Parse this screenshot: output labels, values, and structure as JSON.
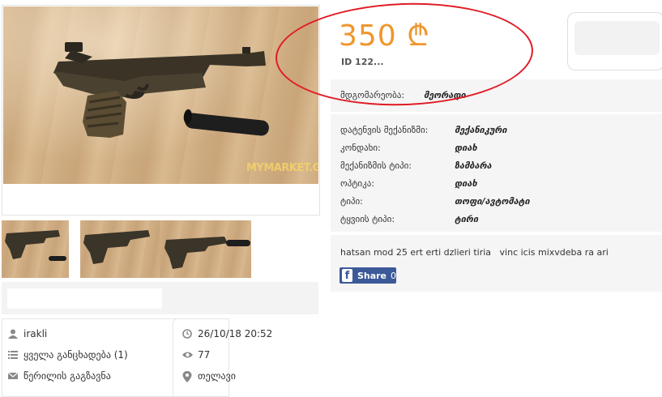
{
  "listing": {
    "watermark": "MYMARKET.GE",
    "price": "350 ₾",
    "id_text": "ID 122..."
  },
  "condition": {
    "label": "მდგომარეობა:",
    "value": "მეორადი"
  },
  "specs": [
    {
      "label": "დატენვის მექანიზმი:",
      "value": "მექანიკური"
    },
    {
      "label": "კონდახი:",
      "value": "დიახ"
    },
    {
      "label": "მექანიზმის ტიპი:",
      "value": "ზამბარა"
    },
    {
      "label": "ოპტიკა:",
      "value": "დიახ"
    },
    {
      "label": "ტიპი:",
      "value": "თოფი/ავტომატი"
    },
    {
      "label": "ტყვიის ტიპი:",
      "value": "ტირი"
    }
  ],
  "description": "hatsan mod 25 ert erti dzlieri tiria   vinc icis mixvdeba ra ari",
  "share": {
    "label": "Share",
    "count": "0"
  },
  "seller": {
    "name": "irakli",
    "all_listings": "ყველა განცხადება (1)",
    "send_message": "წერილის გაგზავნა"
  },
  "meta": {
    "date": "26/10/18 20:52",
    "views": "77",
    "location": "თელავი"
  },
  "colors": {
    "price": "#f0962d",
    "annotation": "#e01b24",
    "facebook": "#3b5998"
  },
  "icons": [
    "user-icon",
    "list-icon",
    "envelope-icon",
    "clock-icon",
    "eye-icon",
    "location-pin-icon",
    "facebook-icon"
  ]
}
